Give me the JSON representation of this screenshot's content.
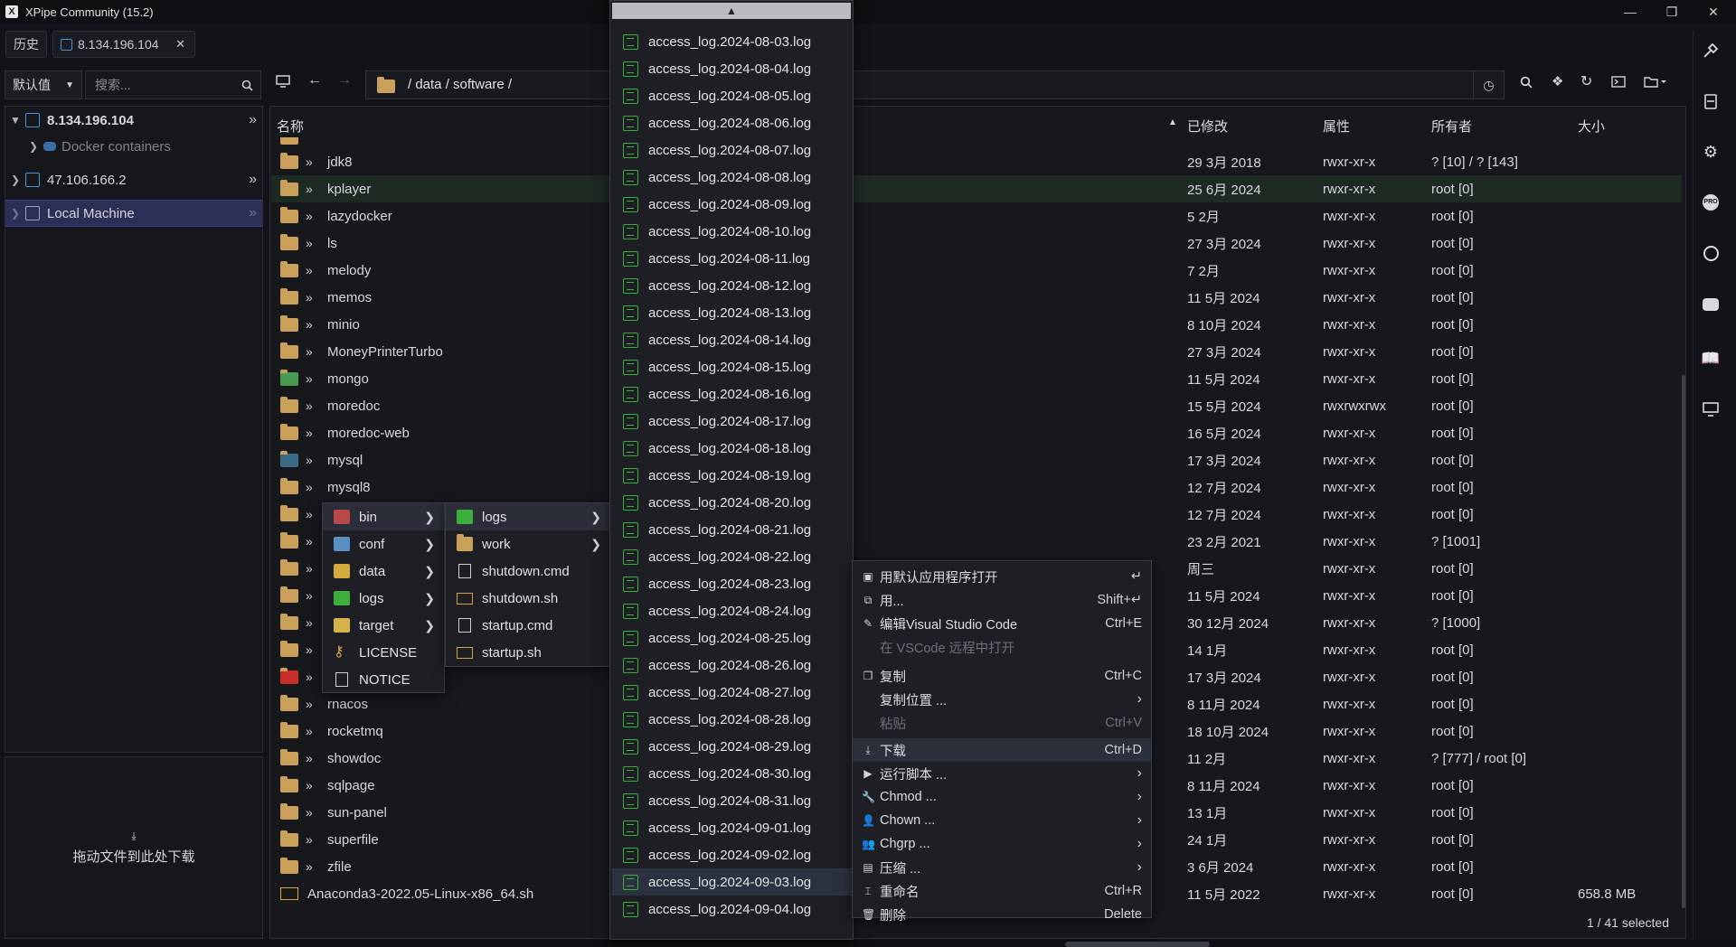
{
  "window": {
    "title": "XPipe Community (15.2)"
  },
  "tabs": {
    "history_label": "历史",
    "active_tab_label": "8.134.196.104"
  },
  "sidebar": {
    "category_select": "默认值",
    "search_placeholder": "搜索...",
    "hosts": [
      {
        "label": "8.134.196.104",
        "child": "Docker containers"
      },
      {
        "label": "47.106.166.2"
      },
      {
        "label": "Local Machine"
      }
    ],
    "drop_hint": "拖动文件到此处下载"
  },
  "browser": {
    "path": "/ data / software /",
    "columns": {
      "name": "名称",
      "modified": "已修改",
      "attrs": "属性",
      "owner": "所有者",
      "size": "大小"
    },
    "rows": [
      {
        "name": "jdk8",
        "modified": "29 3月 2018",
        "attrs": "rwxr-xr-x",
        "owner": "? [10] / ? [143]",
        "size": ""
      },
      {
        "name": "kplayer",
        "modified": "25 6月 2024",
        "attrs": "rwxr-xr-x",
        "owner": "root [0]",
        "size": ""
      },
      {
        "name": "lazydocker",
        "modified": "5 2月",
        "attrs": "rwxr-xr-x",
        "owner": "root [0]",
        "size": ""
      },
      {
        "name": "ls",
        "modified": "27 3月 2024",
        "attrs": "rwxr-xr-x",
        "owner": "root [0]",
        "size": ""
      },
      {
        "name": "melody",
        "modified": "7 2月",
        "attrs": "rwxr-xr-x",
        "owner": "root [0]",
        "size": ""
      },
      {
        "name": "memos",
        "modified": "11 5月 2024",
        "attrs": "rwxr-xr-x",
        "owner": "root [0]",
        "size": ""
      },
      {
        "name": "minio",
        "modified": "8 10月 2024",
        "attrs": "rwxr-xr-x",
        "owner": "root [0]",
        "size": ""
      },
      {
        "name": "MoneyPrinterTurbo",
        "modified": "27 3月 2024",
        "attrs": "rwxr-xr-x",
        "owner": "root [0]",
        "size": ""
      },
      {
        "name": "mongo",
        "modified": "11 5月 2024",
        "attrs": "rwxr-xr-x",
        "owner": "root [0]",
        "size": ""
      },
      {
        "name": "moredoc",
        "modified": "15 5月 2024",
        "attrs": "rwxrwxrwx",
        "owner": "root [0]",
        "size": ""
      },
      {
        "name": "moredoc-web",
        "modified": "16 5月 2024",
        "attrs": "rwxr-xr-x",
        "owner": "root [0]",
        "size": ""
      },
      {
        "name": "mysql",
        "modified": "17 3月 2024",
        "attrs": "rwxr-xr-x",
        "owner": "root [0]",
        "size": ""
      },
      {
        "name": "mysql8",
        "modified": "12 7月 2024",
        "attrs": "rwxr-xr-x",
        "owner": "root [0]",
        "size": ""
      },
      {
        "name": "",
        "modified": "12 7月 2024",
        "attrs": "rwxr-xr-x",
        "owner": "root [0]",
        "size": ""
      },
      {
        "name": "",
        "modified": "23 2月 2021",
        "attrs": "rwxr-xr-x",
        "owner": "? [1001]",
        "size": ""
      },
      {
        "name": "",
        "modified": "周三",
        "attrs": "rwxr-xr-x",
        "owner": "root [0]",
        "size": ""
      },
      {
        "name": "",
        "modified": "11 5月 2024",
        "attrs": "rwxr-xr-x",
        "owner": "root [0]",
        "size": ""
      },
      {
        "name": "",
        "modified": "30 12月 2024",
        "attrs": "rwxr-xr-x",
        "owner": "? [1000]",
        "size": ""
      },
      {
        "name": "",
        "modified": "14 1月",
        "attrs": "rwxr-xr-x",
        "owner": "root [0]",
        "size": ""
      },
      {
        "name": "",
        "modified": "17 3月 2024",
        "attrs": "rwxr-xr-x",
        "owner": "root [0]",
        "size": ""
      },
      {
        "name": "rnacos",
        "modified": "8 11月 2024",
        "attrs": "rwxr-xr-x",
        "owner": "root [0]",
        "size": ""
      },
      {
        "name": "rocketmq",
        "modified": "18 10月 2024",
        "attrs": "rwxr-xr-x",
        "owner": "root [0]",
        "size": ""
      },
      {
        "name": "showdoc",
        "modified": "11 2月",
        "attrs": "rwxr-xr-x",
        "owner": "? [777] / root [0]",
        "size": ""
      },
      {
        "name": "sqlpage",
        "modified": "8 11月 2024",
        "attrs": "rwxr-xr-x",
        "owner": "root [0]",
        "size": ""
      },
      {
        "name": "sun-panel",
        "modified": "13 1月",
        "attrs": "rwxr-xr-x",
        "owner": "root [0]",
        "size": ""
      },
      {
        "name": "superfile",
        "modified": "24 1月",
        "attrs": "rwxr-xr-x",
        "owner": "root [0]",
        "size": ""
      },
      {
        "name": "zfile",
        "modified": "3 6月 2024",
        "attrs": "rwxr-xr-x",
        "owner": "root [0]",
        "size": ""
      },
      {
        "name": "Anaconda3-2022.05-Linux-x86_64.sh",
        "modified": "11 5月 2022",
        "attrs": "rwxr-xr-x",
        "owner": "root [0]",
        "size": "658.8 MB"
      }
    ],
    "status": "1 / 41 selected"
  },
  "submenu1": [
    "bin",
    "conf",
    "data",
    "logs",
    "target",
    "LICENSE",
    "NOTICE"
  ],
  "submenu2": [
    "logs",
    "work",
    "shutdown.cmd",
    "shutdown.sh",
    "startup.cmd",
    "startup.sh"
  ],
  "log_menu": {
    "scroll_up": "▲",
    "items": [
      "access_log.2024-08-03.log",
      "access_log.2024-08-04.log",
      "access_log.2024-08-05.log",
      "access_log.2024-08-06.log",
      "access_log.2024-08-07.log",
      "access_log.2024-08-08.log",
      "access_log.2024-08-09.log",
      "access_log.2024-08-10.log",
      "access_log.2024-08-11.log",
      "access_log.2024-08-12.log",
      "access_log.2024-08-13.log",
      "access_log.2024-08-14.log",
      "access_log.2024-08-15.log",
      "access_log.2024-08-16.log",
      "access_log.2024-08-17.log",
      "access_log.2024-08-18.log",
      "access_log.2024-08-19.log",
      "access_log.2024-08-20.log",
      "access_log.2024-08-21.log",
      "access_log.2024-08-22.log",
      "access_log.2024-08-23.log",
      "access_log.2024-08-24.log",
      "access_log.2024-08-25.log",
      "access_log.2024-08-26.log",
      "access_log.2024-08-27.log",
      "access_log.2024-08-28.log",
      "access_log.2024-08-29.log",
      "access_log.2024-08-30.log",
      "access_log.2024-08-31.log",
      "access_log.2024-09-01.log",
      "access_log.2024-09-02.log",
      "access_log.2024-09-03.log",
      "access_log.2024-09-04.log"
    ]
  },
  "context_menu": [
    {
      "label": "用默认应用程序打开",
      "key": "↵",
      "icon": "open-icon"
    },
    {
      "label": "用...",
      "key": "Shift+↵",
      "icon": "open-with-icon"
    },
    {
      "label": "编辑Visual Studio Code",
      "key": "Ctrl+E",
      "icon": "edit-icon"
    },
    {
      "label": "在 VSCode 远程中打开",
      "key": "",
      "icon": ""
    },
    {
      "label": "复制",
      "key": "Ctrl+C",
      "icon": "copy-icon"
    },
    {
      "label": "复制位置 ...",
      "key": "",
      "icon": ""
    },
    {
      "label": "粘贴",
      "key": "Ctrl+V",
      "icon": ""
    },
    {
      "label": "下载",
      "key": "Ctrl+D",
      "icon": "download-icon"
    },
    {
      "label": "运行脚本 ...",
      "key": "",
      "icon": "script-icon"
    },
    {
      "label": "Chmod ...",
      "key": "",
      "icon": "wrench-icon"
    },
    {
      "label": "Chown ...",
      "key": "",
      "icon": "user-icon"
    },
    {
      "label": "Chgrp ...",
      "key": "",
      "icon": "group-icon"
    },
    {
      "label": "压缩 ...",
      "key": "",
      "icon": "archive-icon"
    },
    {
      "label": "重命名",
      "key": "Ctrl+R",
      "icon": "rename-icon"
    },
    {
      "label": "删除",
      "key": "Delete",
      "icon": "trash-icon"
    }
  ],
  "colors": {
    "accent": "#3a3f8f",
    "selection": "#2b2f3a",
    "folder": "#c9a15a",
    "log_icon": "#3cae3c"
  }
}
